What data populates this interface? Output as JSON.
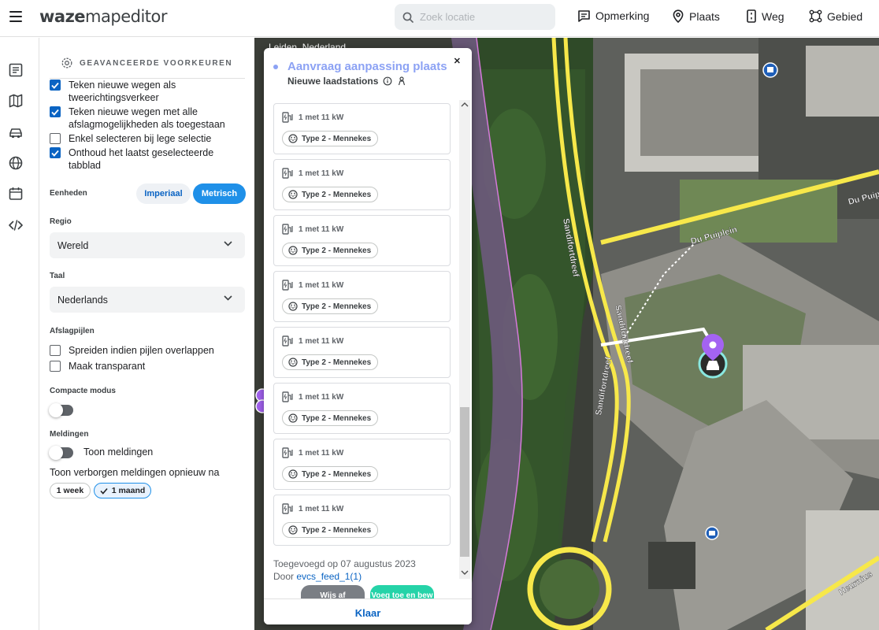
{
  "app": {
    "logo_bold": "waze",
    "logo_regular": "mapeditor"
  },
  "search": {
    "placeholder": "Zoek locatie"
  },
  "topnav": {
    "items": [
      {
        "label": "Opmerking",
        "icon": "comment-icon"
      },
      {
        "label": "Plaats",
        "icon": "place-pin-icon"
      },
      {
        "label": "Weg",
        "icon": "road-icon"
      },
      {
        "label": "Gebied",
        "icon": "area-icon"
      }
    ]
  },
  "sidenav": {
    "icons": [
      "layers-list-icon",
      "map-icon",
      "car-icon",
      "globe-icon",
      "calendar-icon",
      "code-icon"
    ]
  },
  "prefs": {
    "title": "GEAVANCEERDE VOORKEUREN",
    "checks": [
      {
        "label": "Teken nieuwe wegen als tweerichtingsverkeer",
        "checked": true
      },
      {
        "label": "Teken nieuwe wegen met alle afslagmogelijkheden als toegestaan",
        "checked": true
      },
      {
        "label": "Enkel selecteren bij lege selectie",
        "checked": false
      },
      {
        "label": "Onthoud het laatst geselecteerde tabblad",
        "checked": true
      }
    ],
    "units": {
      "label": "Eenheden",
      "imperial": "Imperiaal",
      "metric": "Metrisch",
      "selected": "Metrisch"
    },
    "region": {
      "label": "Regio",
      "value": "Wereld"
    },
    "language": {
      "label": "Taal",
      "value": "Nederlands"
    },
    "arrows": {
      "label": "Afslagpijlen",
      "options": [
        {
          "label": "Spreiden indien pijlen overlappen",
          "checked": false
        },
        {
          "label": "Maak transparant",
          "checked": false
        }
      ]
    },
    "compact": {
      "label": "Compacte modus",
      "on": false
    },
    "notifications": {
      "label": "Meldingen",
      "toggle_label": "Toon meldingen",
      "on": false,
      "reshow_label": "Toon verborgen meldingen opnieuw na",
      "week": "1 week",
      "month": "1 maand",
      "selected": "1 maand"
    }
  },
  "map": {
    "location_label": "Leiden, Nederland",
    "street_labels": [
      "Sandifortdreef",
      "Sandifortdreef",
      "Sandifortdreef",
      "Du Puiplein",
      "Du Puiplein",
      "Heurnius"
    ]
  },
  "dialog": {
    "title": "Aanvraag aanpassing plaats",
    "subtitle": "Nieuwe laadstations",
    "stations": [
      {
        "power": "1 met 11 kW",
        "connector": "Type 2 - Mennekes"
      },
      {
        "power": "1 met 11 kW",
        "connector": "Type 2 - Mennekes"
      },
      {
        "power": "1 met 11 kW",
        "connector": "Type 2 - Mennekes"
      },
      {
        "power": "1 met 11 kW",
        "connector": "Type 2 - Mennekes"
      },
      {
        "power": "1 met 11 kW",
        "connector": "Type 2 - Mennekes"
      },
      {
        "power": "1 met 11 kW",
        "connector": "Type 2 - Mennekes"
      },
      {
        "power": "1 met 11 kW",
        "connector": "Type 2 - Mennekes"
      },
      {
        "power": "1 met 11 kW",
        "connector": "Type 2 - Mennekes"
      }
    ],
    "added": "Toegevoegd op 07 augustus 2023",
    "by_prefix": "Door",
    "by_user": "evcs_feed_1(1)",
    "reject": "Wijs af",
    "accept": "Voeg toe en bew",
    "done": "Klaar"
  },
  "colors": {
    "accent_blue": "#0b64c3",
    "title_lilac": "#8ca2f4",
    "accept_green": "#25d3a8",
    "road_yellow": "#f7e84a",
    "pin_purple": "#a463f2"
  }
}
